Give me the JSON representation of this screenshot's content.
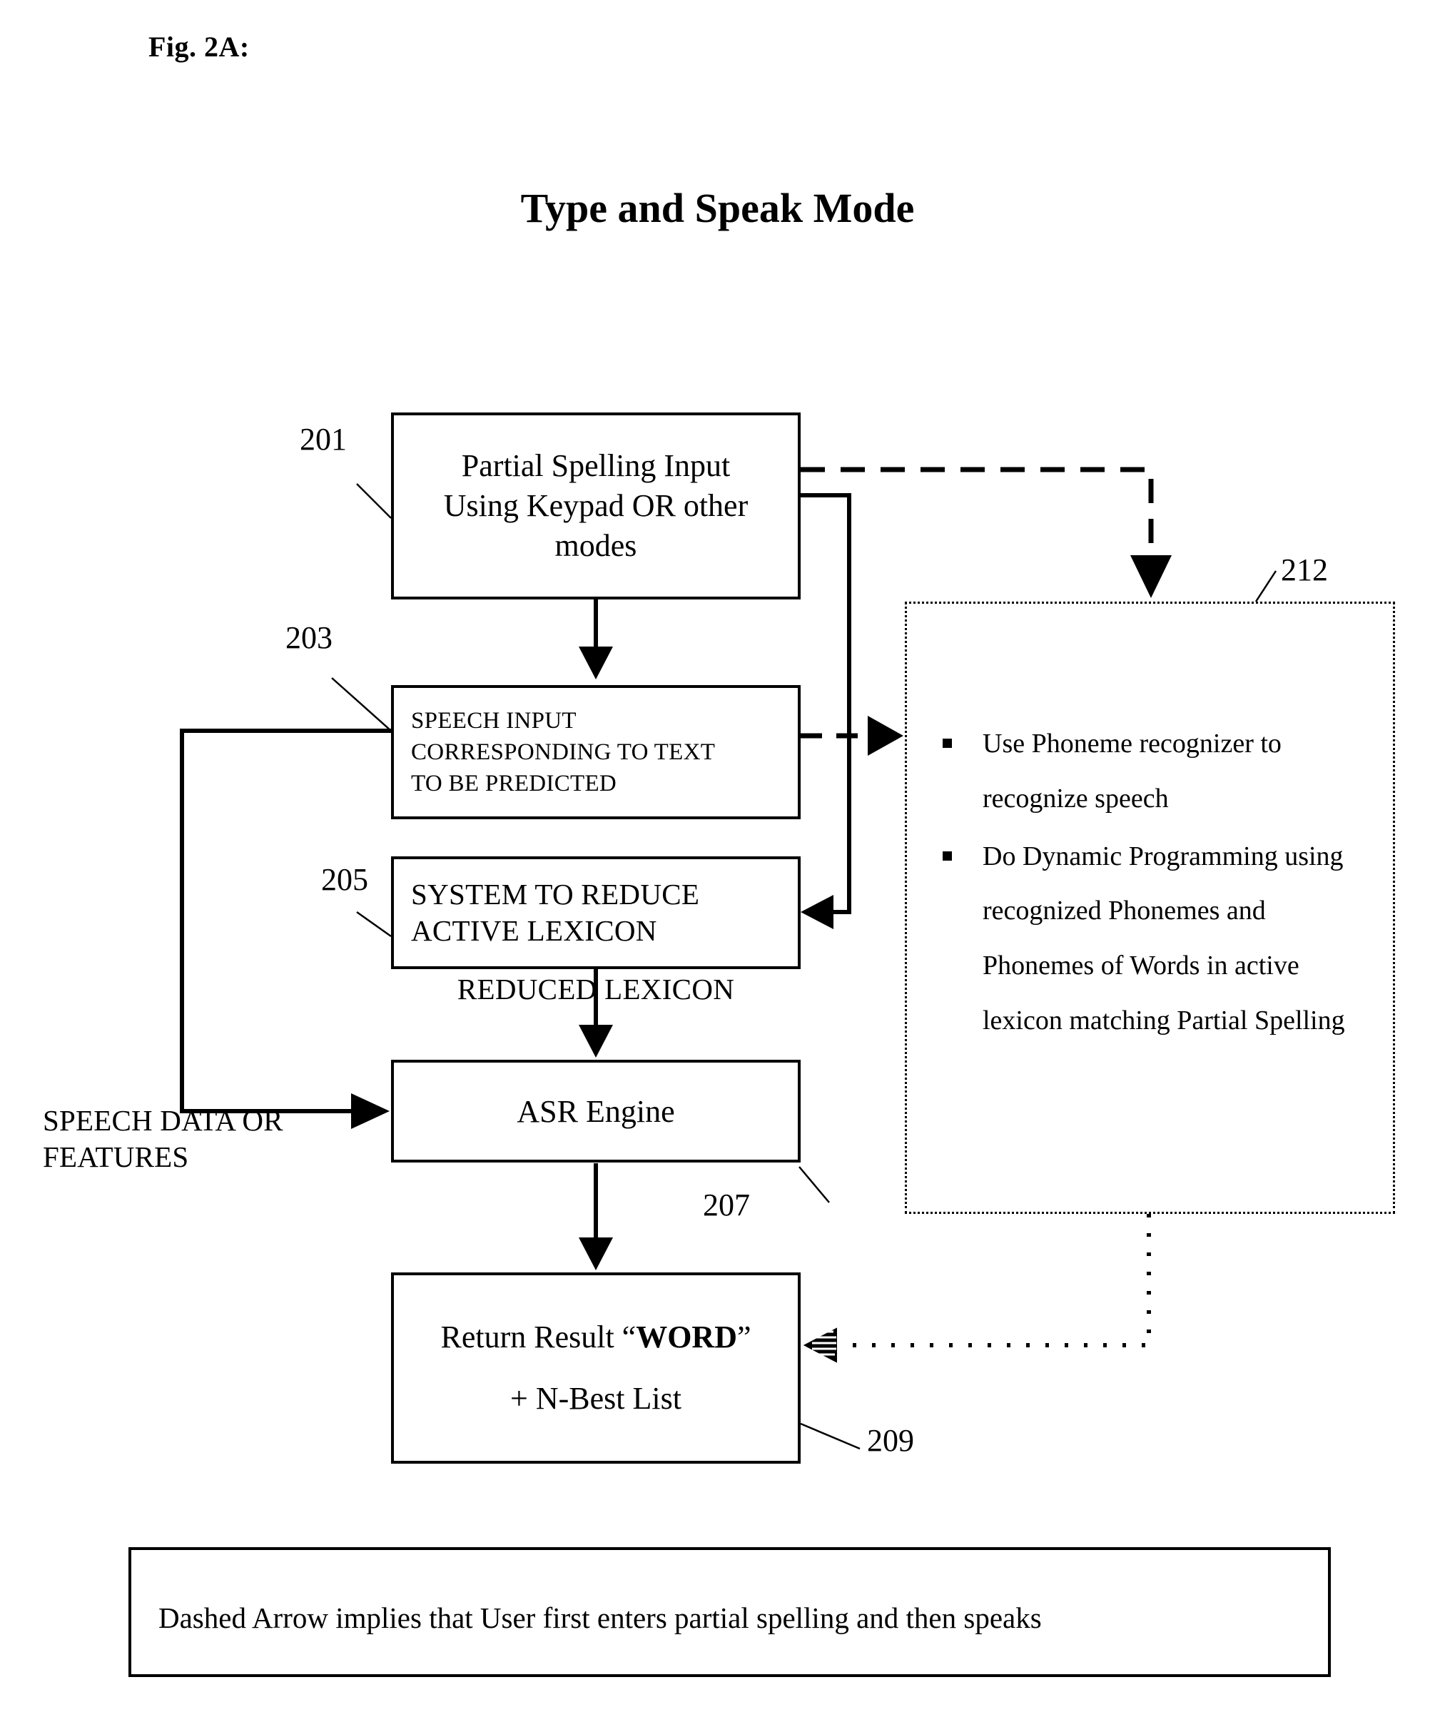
{
  "figure": {
    "label": "Fig. 2A:",
    "title": "Type and Speak Mode"
  },
  "nodes": {
    "n201": {
      "ref": "201",
      "line1": "Partial Spelling Input",
      "line2": "Using Keypad OR other",
      "line3": "modes"
    },
    "n203": {
      "ref": "203",
      "line1": "SPEECH INPUT",
      "line2": "CORRESPONDING TO TEXT",
      "line3": "TO BE PREDICTED"
    },
    "n205": {
      "ref": "205",
      "line1": "SYSTEM TO REDUCE",
      "line2": "ACTIVE LEXICON"
    },
    "n207": {
      "ref": "207",
      "label": "ASR Engine"
    },
    "n209": {
      "ref": "209",
      "line1_prefix": "Return Result “",
      "line1_bold": "WORD",
      "line1_suffix": "”",
      "line2": "+ N-Best List"
    },
    "panel212": {
      "ref": "212",
      "bullets": [
        "Use Phoneme recognizer to recognize speech",
        "Do Dynamic Programming using recognized Phonemes and Phonemes of Words in active lexicon matching Partial Spelling"
      ]
    }
  },
  "edge_labels": {
    "reduced_lexicon": "REDUCED  LEXICON",
    "speech_data_line1": "SPEECH DATA OR",
    "speech_data_line2": "FEATURES"
  },
  "legend": {
    "text": "Dashed Arrow implies that User first enters partial spelling and then speaks"
  },
  "colors": {
    "stroke": "#000000",
    "background": "#ffffff"
  }
}
